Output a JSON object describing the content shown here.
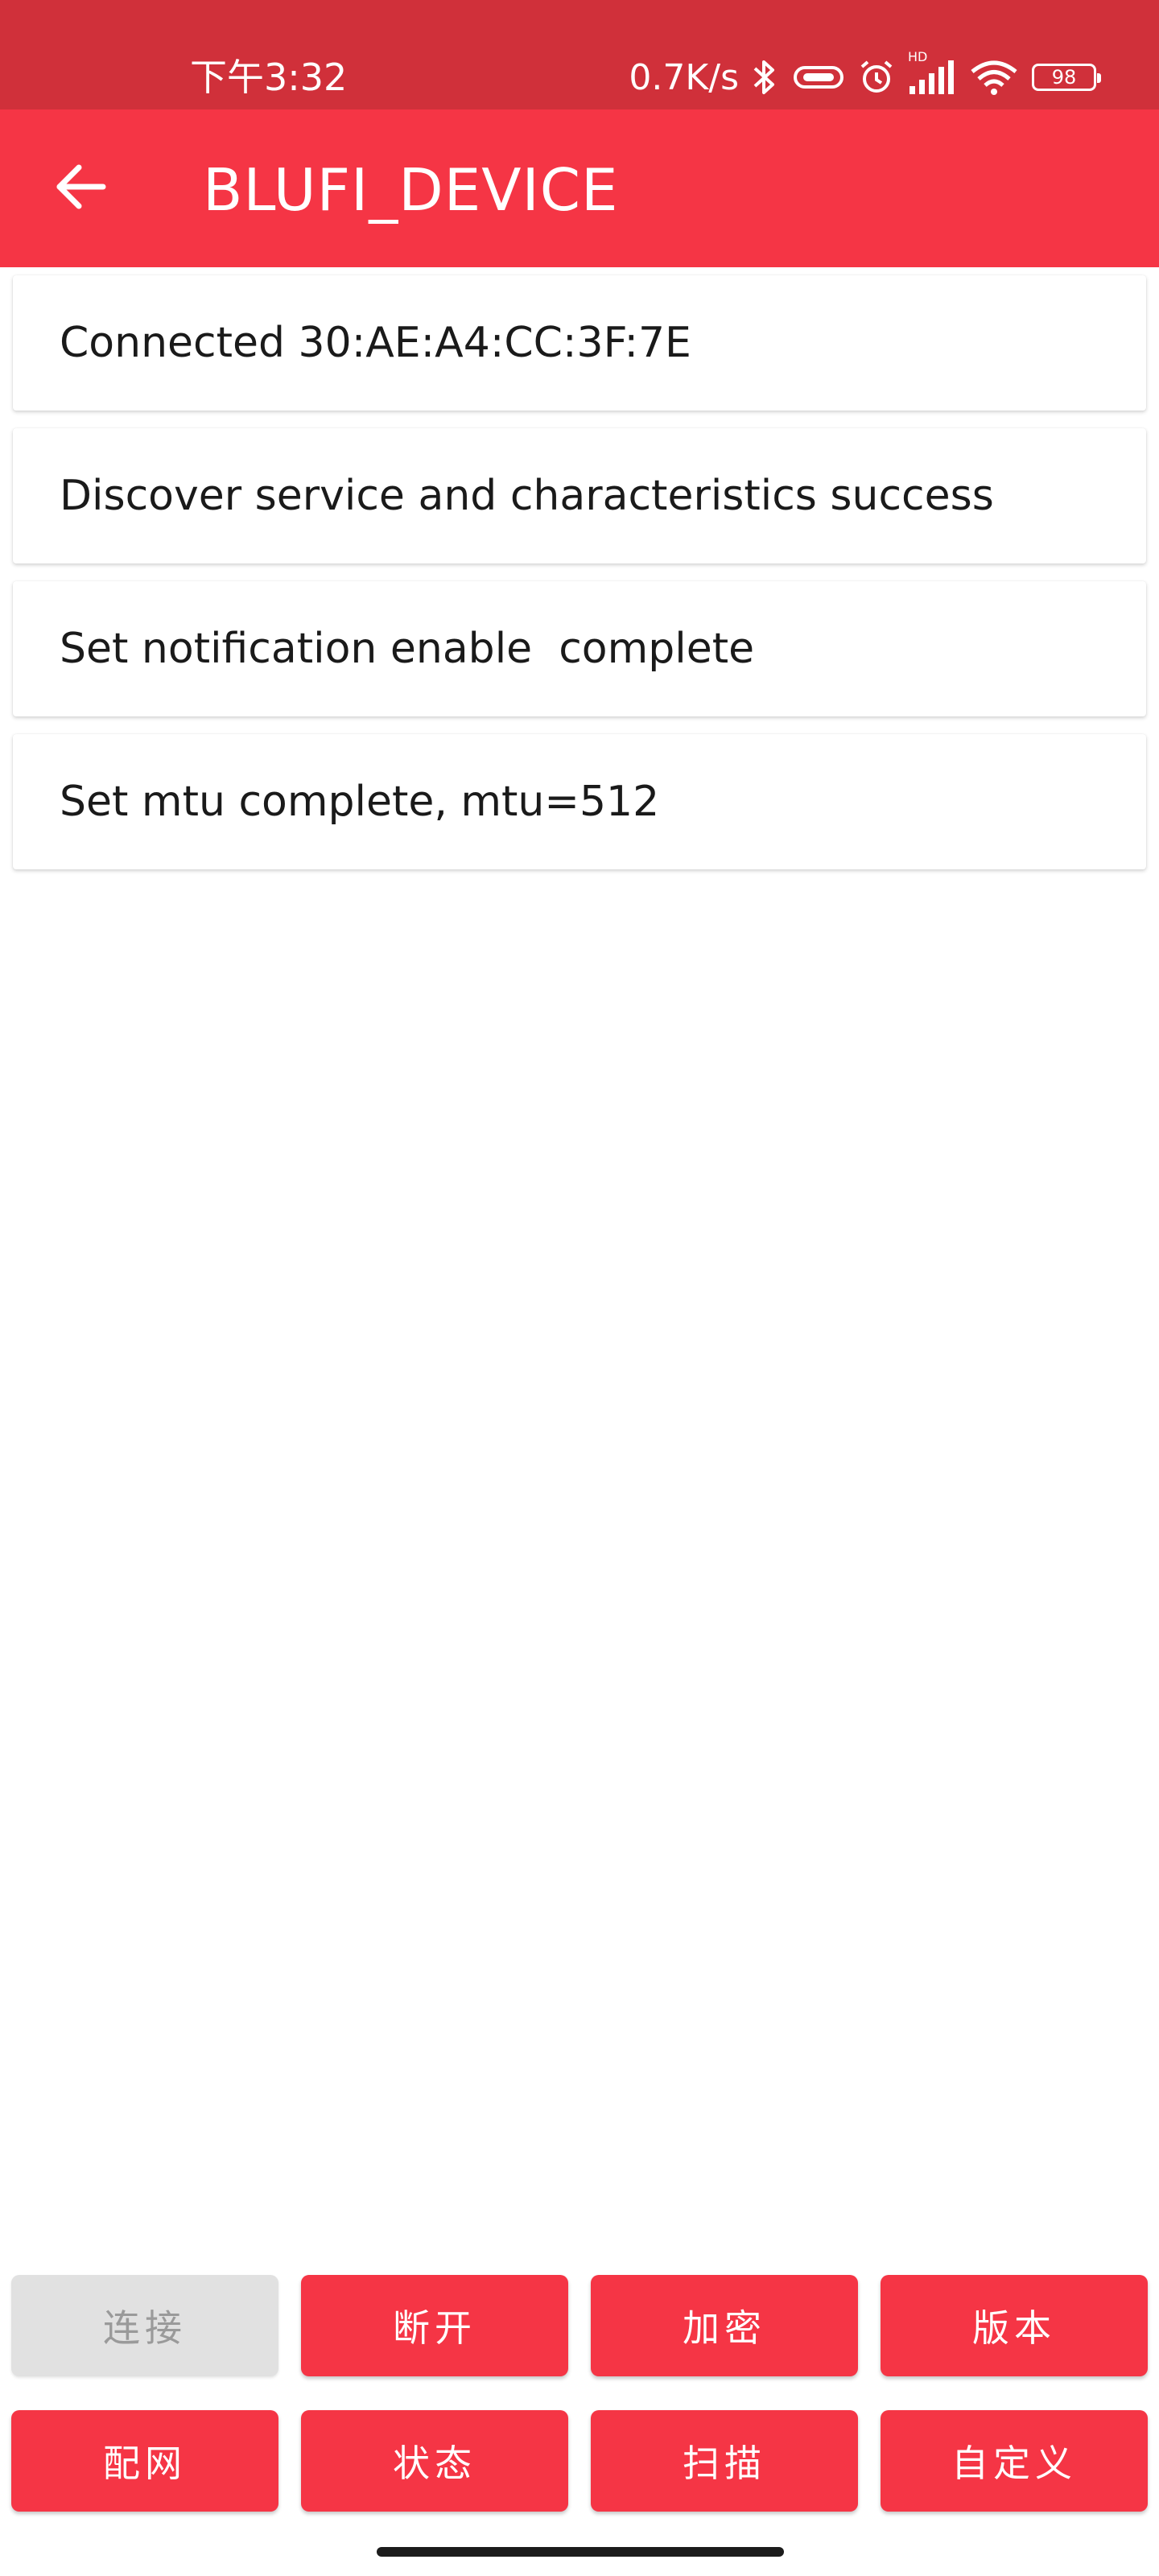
{
  "status_bar": {
    "time": "下午3:32",
    "network_speed": "0.7K/s",
    "hd_label": "HD",
    "battery_level": "98",
    "icons": [
      "bluetooth-icon",
      "vibrate-icon",
      "alarm-icon",
      "signal-icon",
      "wifi-icon",
      "battery-icon"
    ]
  },
  "app_bar": {
    "title": "BLUFI_DEVICE",
    "back_icon": "arrow-left-icon"
  },
  "log": [
    "Connected 30:AE:A4:CC:3F:7E",
    "Discover service and characteristics success",
    "Set notification enable  complete",
    "Set mtu complete, mtu=512"
  ],
  "buttons": {
    "connect": "连接",
    "disconnect": "断开",
    "encrypt": "加密",
    "version": "版本",
    "configure": "配网",
    "state": "状态",
    "scan": "扫描",
    "custom": "自定义"
  },
  "colors": {
    "status_bar": "#d0303a",
    "app_bar": "#f53545",
    "button": "#f53545",
    "button_disabled": "#e1e1e1"
  }
}
